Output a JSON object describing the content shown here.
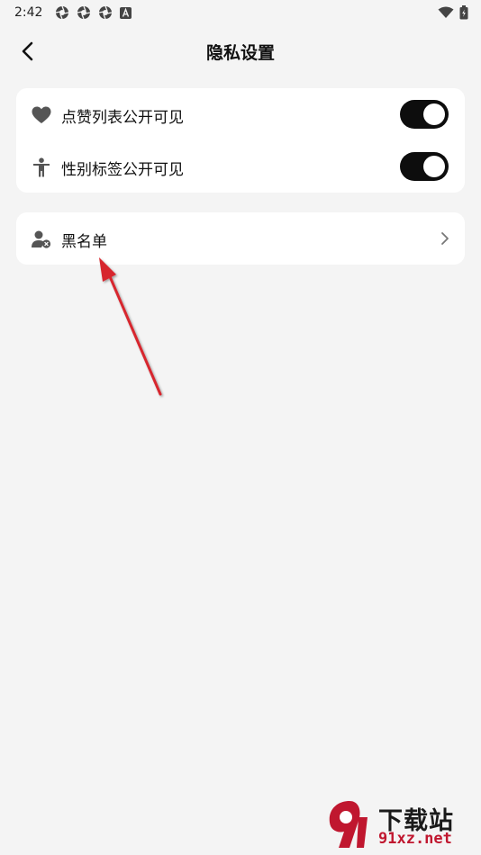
{
  "status_bar": {
    "time": "2:42",
    "left_icons": [
      "aperture-icon",
      "aperture-icon",
      "aperture-icon",
      "a-badge-icon"
    ],
    "right_icons": [
      "wifi-icon",
      "battery-icon"
    ]
  },
  "header": {
    "title": "隐私设置",
    "back_icon": "chevron-left-icon"
  },
  "privacy_card": {
    "items": [
      {
        "label": "点赞列表公开可见",
        "icon": "heart-icon",
        "toggle_on": true
      },
      {
        "label": "性别标签公开可见",
        "icon": "person-icon",
        "toggle_on": true
      }
    ]
  },
  "blacklist_card": {
    "label": "黑名单",
    "icon": "user-blocked-icon",
    "chevron_icon": "chevron-right-icon"
  },
  "annotation": {
    "arrow_color": "#d7262d"
  },
  "watermark": {
    "main_text": "下载站",
    "sub_text": "91xz.net",
    "accent": "#c0172f"
  },
  "colors": {
    "background": "#f4f4f4",
    "card": "#ffffff",
    "toggle_on": "#0d0d0d"
  }
}
